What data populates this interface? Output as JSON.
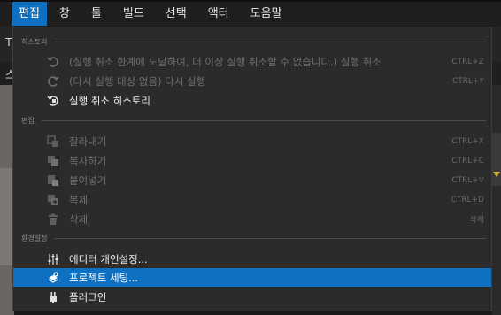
{
  "menubar": {
    "items": [
      {
        "label": "편집",
        "active": true
      },
      {
        "label": "창",
        "active": false
      },
      {
        "label": "툴",
        "active": false
      },
      {
        "label": "빌드",
        "active": false
      },
      {
        "label": "선택",
        "active": false
      },
      {
        "label": "액터",
        "active": false
      },
      {
        "label": "도움말",
        "active": false
      }
    ]
  },
  "background": {
    "fragment_t": "T",
    "fragment_s": "스"
  },
  "dropdown": {
    "sections": {
      "history": "히스토리",
      "edit": "편집",
      "settings": "환경설정"
    },
    "history": [
      {
        "icon": "undo-icon",
        "label": "(실행 취소 한계에 도달하여, 더 이상 실행 취소할 수 없습니다.) 실행 취소",
        "shortcut": "CTRL+Z",
        "enabled": false
      },
      {
        "icon": "redo-icon",
        "label": "(다시 실행 대상 없음) 다시 실행",
        "shortcut": "CTRL+Y",
        "enabled": false
      },
      {
        "icon": "undo-history-icon",
        "label": "실행 취소 히스토리",
        "shortcut": "",
        "enabled": true
      }
    ],
    "edit": [
      {
        "icon": "cut-icon",
        "label": "잘라내기",
        "shortcut": "CTRL+X",
        "enabled": false
      },
      {
        "icon": "copy-icon",
        "label": "복사하기",
        "shortcut": "CTRL+C",
        "enabled": false
      },
      {
        "icon": "paste-icon",
        "label": "붙여넣기",
        "shortcut": "CTRL+V",
        "enabled": false
      },
      {
        "icon": "duplicate-icon",
        "label": "복제",
        "shortcut": "CTRL+D",
        "enabled": false
      },
      {
        "icon": "delete-icon",
        "label": "삭제",
        "shortcut": "삭제",
        "enabled": false
      }
    ],
    "settings": [
      {
        "icon": "sliders-icon",
        "label": "에디터 개인설정...",
        "shortcut": "",
        "enabled": true,
        "highlighted": false
      },
      {
        "icon": "project-settings-icon",
        "label": "프로젝트 세팅...",
        "shortcut": "",
        "enabled": true,
        "highlighted": true
      },
      {
        "icon": "plugin-icon",
        "label": "플러그인",
        "shortcut": "",
        "enabled": true,
        "highlighted": false
      }
    ]
  },
  "colors": {
    "accent": "#0e70c0",
    "menu_bg": "#2b2b2b",
    "disabled_text": "#6f6f6f",
    "enabled_text": "#ececec"
  }
}
